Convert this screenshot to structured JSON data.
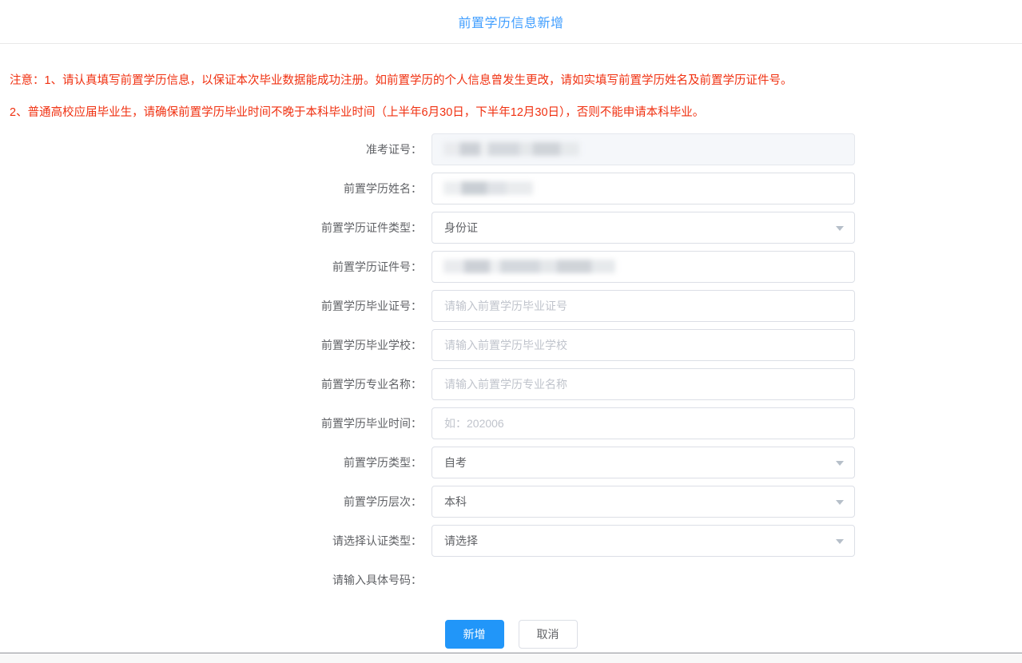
{
  "header": {
    "title": "前置学历信息新增"
  },
  "notices": [
    "注意：1、请认真填写前置学历信息，以保证本次毕业数据能成功注册。如前置学历的个人信息曾发生更改，请如实填写前置学历姓名及前置学历证件号。",
    "2、普通高校应届毕业生，请确保前置学历毕业时间不晚于本科毕业时间（上半年6月30日，下半年12月30日），否则不能申请本科毕业。"
  ],
  "form": {
    "fields": [
      {
        "label": "准考证号：",
        "type": "input",
        "value": "",
        "placeholder": "",
        "disabled": true,
        "redacted": true,
        "redact_width": "w-md"
      },
      {
        "label": "前置学历姓名：",
        "type": "input",
        "value": "",
        "placeholder": "",
        "disabled": false,
        "redacted": true,
        "redact_width": "w-sm"
      },
      {
        "label": "前置学历证件类型：",
        "type": "select",
        "value": "身份证",
        "disabled": false,
        "redacted": false
      },
      {
        "label": "前置学历证件号：",
        "type": "input",
        "value": "",
        "placeholder": "",
        "disabled": false,
        "redacted": true,
        "redact_width": "w-lg"
      },
      {
        "label": "前置学历毕业证号：",
        "type": "input",
        "value": "",
        "placeholder": "请输入前置学历毕业证号",
        "disabled": false,
        "redacted": false
      },
      {
        "label": "前置学历毕业学校：",
        "type": "input",
        "value": "",
        "placeholder": "请输入前置学历毕业学校",
        "disabled": false,
        "redacted": false
      },
      {
        "label": "前置学历专业名称：",
        "type": "input",
        "value": "",
        "placeholder": "请输入前置学历专业名称",
        "disabled": false,
        "redacted": false
      },
      {
        "label": "前置学历毕业时间：",
        "type": "input",
        "value": "",
        "placeholder": "如：202006",
        "disabled": false,
        "redacted": false
      },
      {
        "label": "前置学历类型：",
        "type": "select",
        "value": "自考",
        "disabled": false,
        "redacted": false
      },
      {
        "label": "前置学历层次：",
        "type": "select",
        "value": "本科",
        "disabled": false,
        "redacted": false
      },
      {
        "label": "请选择认证类型：",
        "type": "select",
        "value": "请选择",
        "disabled": false,
        "redacted": false
      }
    ],
    "cutoff_label": "请输入具体号码："
  },
  "footer": {
    "submit_label": "新增",
    "cancel_label": "取消"
  },
  "colors": {
    "title_blue": "#409eff",
    "notice_red": "#f03010",
    "primary_button": "#2196f9",
    "border": "#dcdfe6",
    "disabled_bg": "#f5f7fa"
  }
}
